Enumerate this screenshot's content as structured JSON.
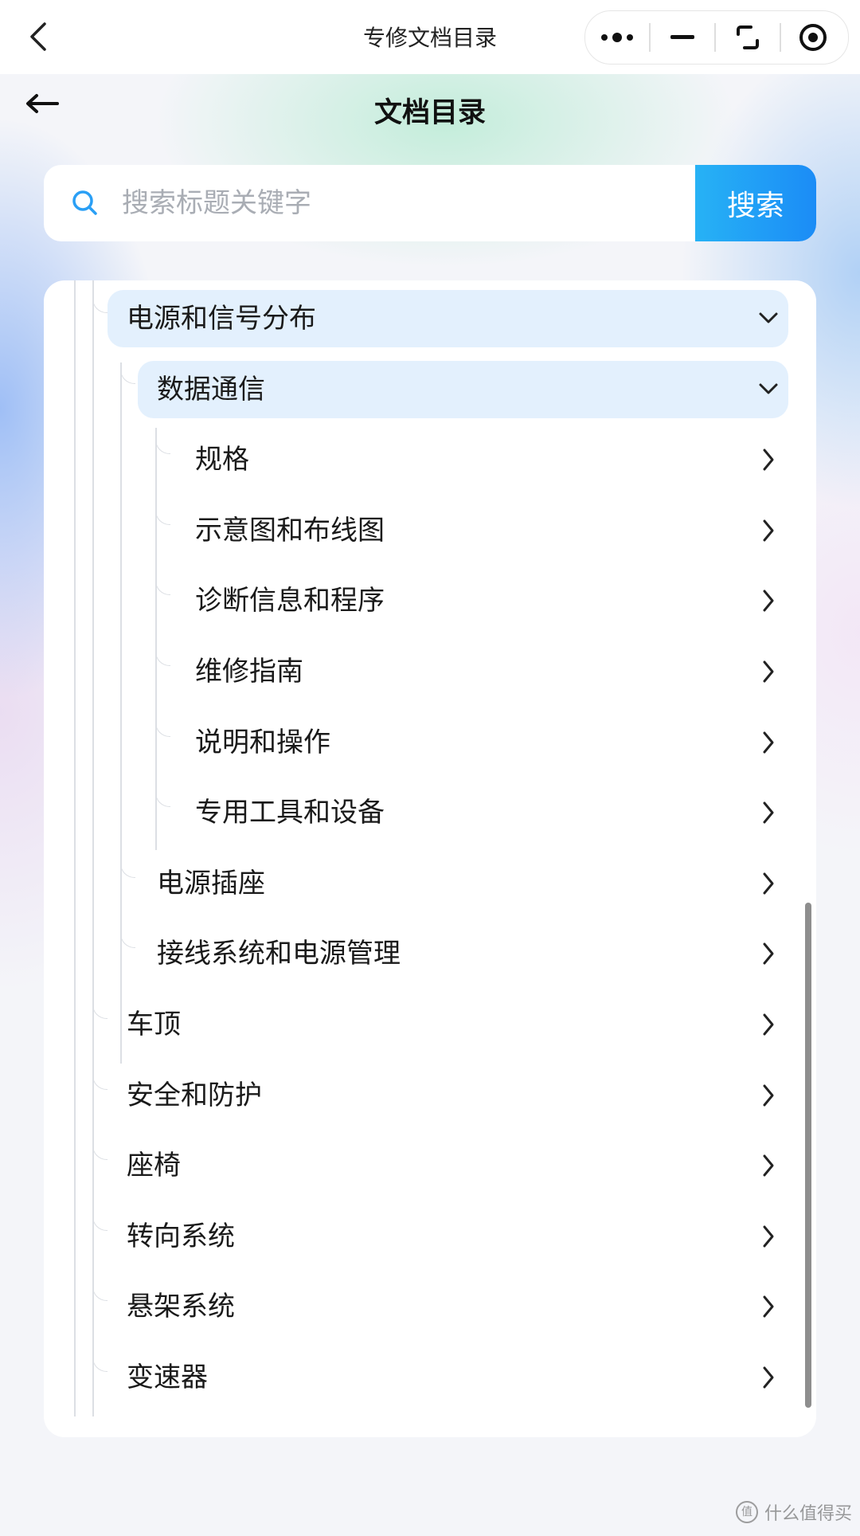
{
  "topbar": {
    "title": "专修文档目录"
  },
  "page": {
    "title": "文档目录"
  },
  "search": {
    "placeholder": "搜索标题关键字",
    "button_label": "搜索"
  },
  "tree": {
    "items": [
      {
        "label": "电源和信号分布",
        "level": 1,
        "expanded": true
      },
      {
        "label": "数据通信",
        "level": 2,
        "expanded": true
      },
      {
        "label": "规格",
        "level": 3
      },
      {
        "label": "示意图和布线图",
        "level": 3
      },
      {
        "label": "诊断信息和程序",
        "level": 3
      },
      {
        "label": "维修指南",
        "level": 3
      },
      {
        "label": "说明和操作",
        "level": 3
      },
      {
        "label": "专用工具和设备",
        "level": 3
      },
      {
        "label": "电源插座",
        "level": 2
      },
      {
        "label": "接线系统和电源管理",
        "level": 2
      },
      {
        "label": "车顶",
        "level": 1
      },
      {
        "label": "安全和防护",
        "level": 1
      },
      {
        "label": "座椅",
        "level": 1
      },
      {
        "label": "转向系统",
        "level": 1
      },
      {
        "label": "悬架系统",
        "level": 1
      },
      {
        "label": "变速器",
        "level": 1
      }
    ]
  },
  "colors": {
    "accent": "#1b8cf6",
    "highlight": "#e3f0fd"
  },
  "watermark": {
    "text": "什么值得买"
  }
}
